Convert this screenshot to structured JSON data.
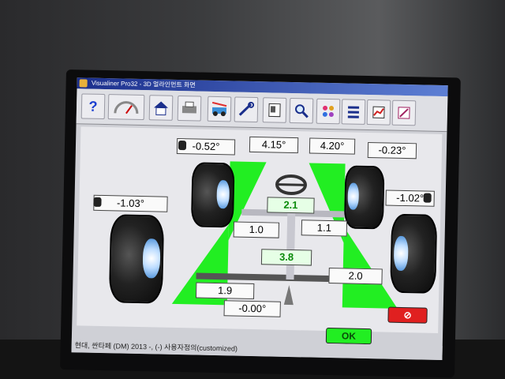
{
  "app": {
    "title": "Visualiner Pro32  -  3D 얼라인먼트 화면"
  },
  "toolbar": {
    "icons": [
      "help-icon",
      "gauge-icon",
      "home-icon",
      "printer-icon",
      "vehicle-spec-icon",
      "tools-icon",
      "report-icon",
      "zoom-icon",
      "settings-dots-icon",
      "list-icon",
      "chart-icon",
      "inspect-icon"
    ],
    "help_glyph": "?"
  },
  "measurements": {
    "front_left_camber": "-0.52°",
    "front_left_toe": "4.15°",
    "front_right_toe": "4.20°",
    "front_right_camber": "-0.23°",
    "front_left_caster": "-1.03°",
    "front_right_caster": "-1.02°",
    "front_total_toe": "2.1",
    "left_setback": "1.0",
    "right_setback": "1.1",
    "rear_total_toe": "3.8",
    "rear_left_toe": "1.9",
    "rear_right_toe": "2.0",
    "thrust_angle": "-0.00°"
  },
  "buttons": {
    "ok_label": "OK",
    "cancel_glyph": "⊘"
  },
  "status": {
    "text": "현대, 싼타페 (DM) 2013 -, (-) 사용자정의(customized)"
  },
  "colors": {
    "indicator_green": "#22ee22",
    "title_blue": "#1b2f8c",
    "cancel_red": "#e02020"
  }
}
